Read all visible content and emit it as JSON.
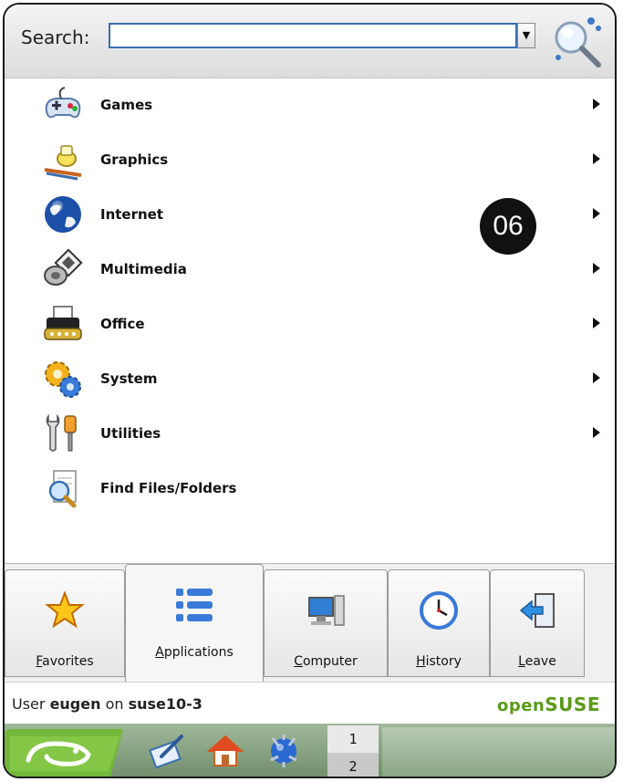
{
  "search": {
    "label": "Search:",
    "value": "",
    "placeholder": ""
  },
  "badge": "06",
  "menu": {
    "items": [
      {
        "label": "Games",
        "icon": "gamepad-icon",
        "has_submenu": true
      },
      {
        "label": "Graphics",
        "icon": "paint-icon",
        "has_submenu": true
      },
      {
        "label": "Internet",
        "icon": "globe-icon",
        "has_submenu": true
      },
      {
        "label": "Multimedia",
        "icon": "speaker-icon",
        "has_submenu": true
      },
      {
        "label": "Office",
        "icon": "typewriter-icon",
        "has_submenu": true
      },
      {
        "label": "System",
        "icon": "gears-icon",
        "has_submenu": true
      },
      {
        "label": "Utilities",
        "icon": "tools-icon",
        "has_submenu": true
      },
      {
        "label": "Find Files/Folders",
        "icon": "find-files-icon",
        "has_submenu": false
      }
    ]
  },
  "tabs": [
    {
      "label": "Favorites",
      "icon": "star-icon",
      "active": false
    },
    {
      "label": "Applications",
      "icon": "list-icon",
      "active": true
    },
    {
      "label": "Computer",
      "icon": "computer-icon",
      "active": false
    },
    {
      "label": "History",
      "icon": "clock-icon",
      "active": false
    },
    {
      "label": "Leave",
      "icon": "exit-icon",
      "active": false
    }
  ],
  "status": {
    "user_prefix": "User ",
    "username": "eugen",
    "host_prefix": " on ",
    "hostname": "suse10-3",
    "brand_open": "open",
    "brand_suse": "SUSE"
  },
  "taskbar": {
    "pager": [
      "1",
      "2"
    ]
  },
  "colors": {
    "accent": "#3a6fb0",
    "brand": "#5a9a1a",
    "taskbar": "#7f9c7a"
  }
}
